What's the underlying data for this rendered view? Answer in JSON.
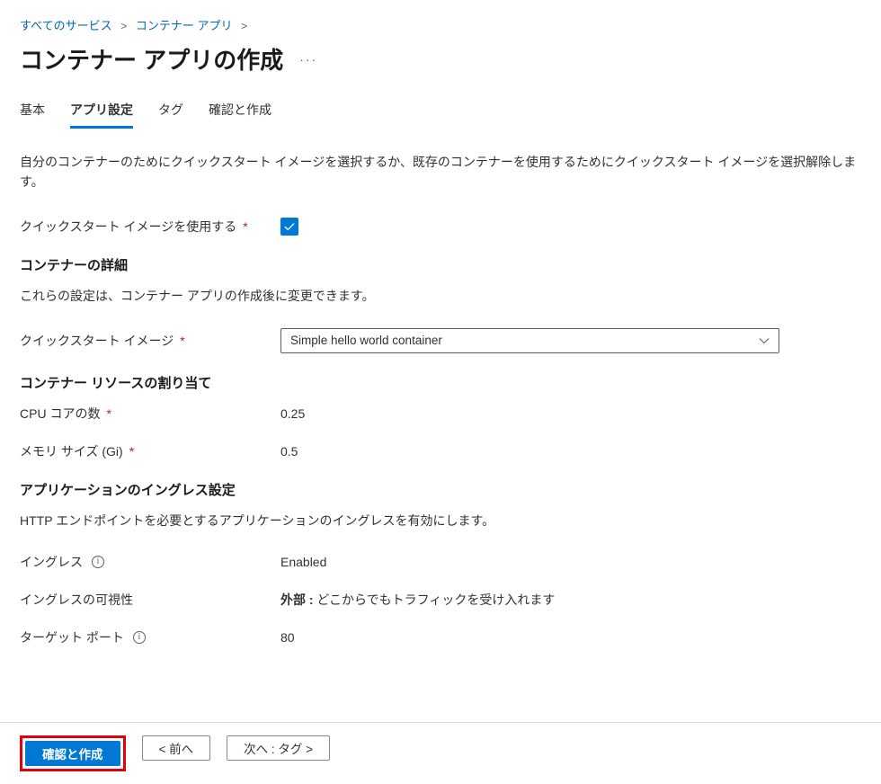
{
  "breadcrumb": {
    "all_services": "すべてのサービス",
    "container_apps": "コンテナー アプリ"
  },
  "title": "コンテナー アプリの作成",
  "tabs": {
    "basic": "基本",
    "app_settings": "アプリ設定",
    "tags": "タグ",
    "review_create": "確認と作成"
  },
  "intro_desc": "自分のコンテナーのためにクイックスタート イメージを選択するか、既存のコンテナーを使用するためにクイックスタート イメージを選択解除します。",
  "quickstart": {
    "label": "クイックスタート イメージを使用する",
    "checked": true
  },
  "container_details": {
    "heading": "コンテナーの詳細",
    "desc": "これらの設定は、コンテナー アプリの作成後に変更できます。",
    "image_label": "クイックスタート イメージ",
    "image_value": "Simple hello world container"
  },
  "resources": {
    "heading": "コンテナー リソースの割り当て",
    "cpu_label": "CPU コアの数",
    "cpu_value": "0.25",
    "mem_label": "メモリ サイズ (Gi)",
    "mem_value": "0.5"
  },
  "ingress": {
    "heading": "アプリケーションのイングレス設定",
    "desc": "HTTP エンドポイントを必要とするアプリケーションのイングレスを有効にします。",
    "ingress_label": "イングレス",
    "ingress_value": "Enabled",
    "visibility_label": "イングレスの可視性",
    "visibility_value_bold": "外部 :",
    "visibility_value_rest": " どこからでもトラフィックを受け入れます",
    "port_label": "ターゲット ポート",
    "port_value": "80"
  },
  "footer": {
    "review_create": "確認と作成",
    "previous": "< 前へ",
    "next": "次へ : タグ >"
  }
}
